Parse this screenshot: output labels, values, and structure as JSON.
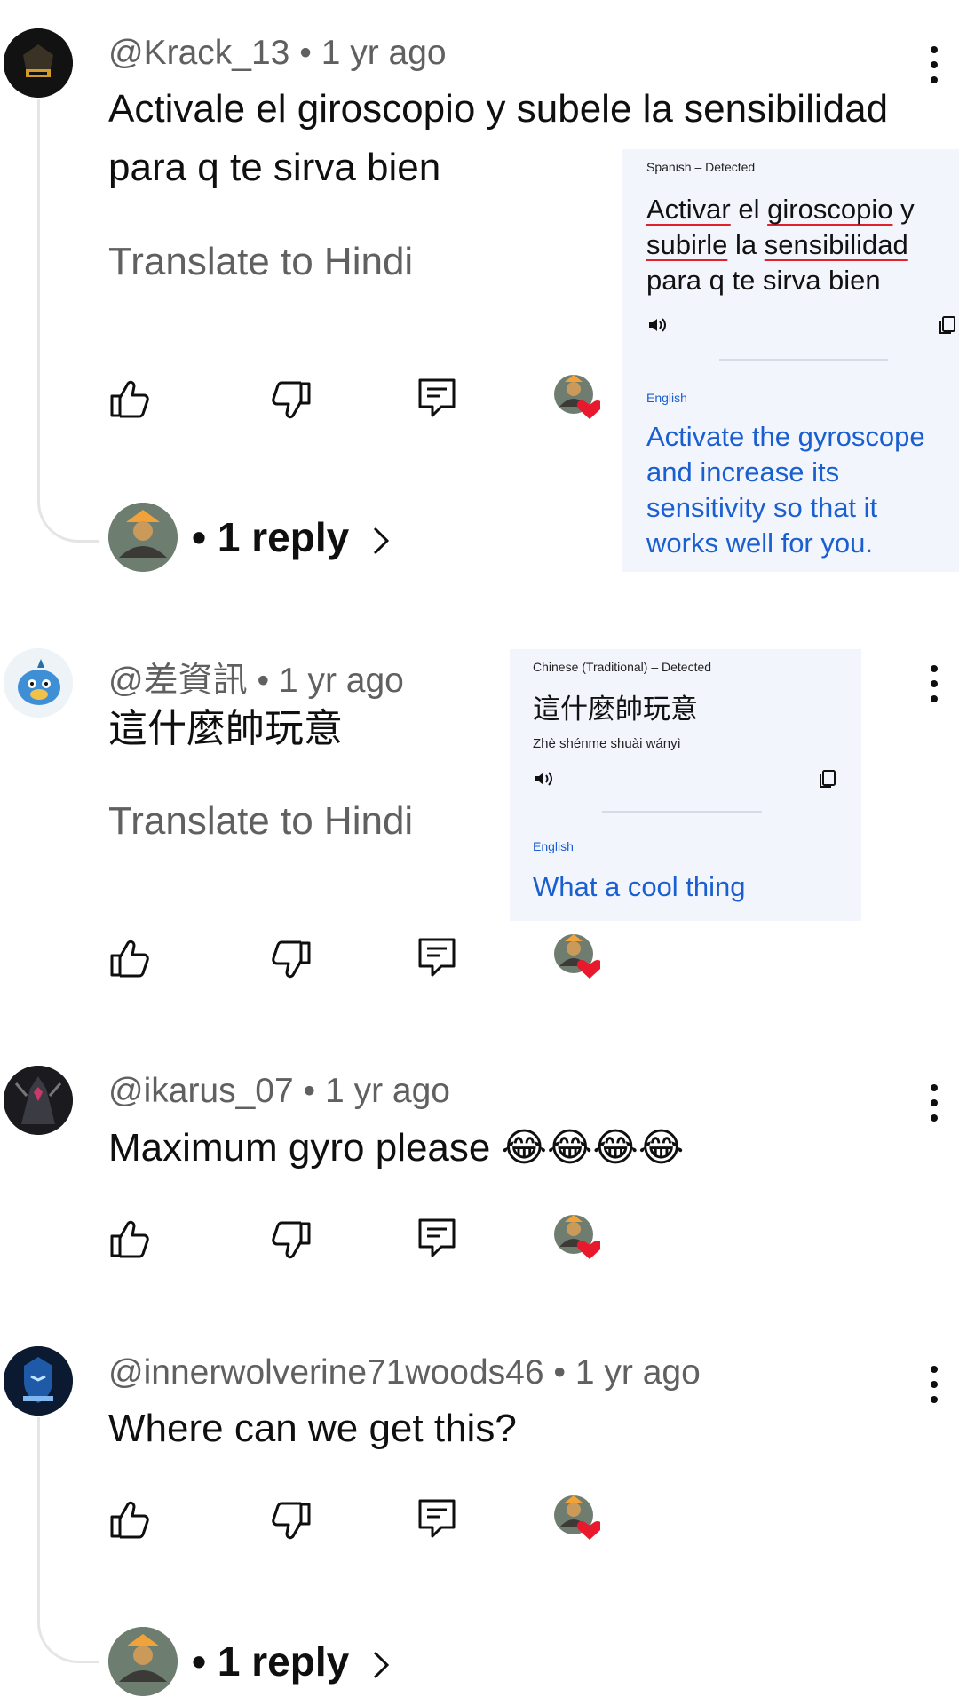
{
  "comments": [
    {
      "handle": "@Krack_13",
      "age": "1 yr ago",
      "text_line1": "Activale el giroscopio y subele la sensibilidad",
      "text_line2": "para q te sirva bien",
      "translate": "Translate to Hindi",
      "reply_text": "• 1 reply"
    },
    {
      "handle": "@差資訊",
      "age": "1 yr ago",
      "text_line1": "這什麼帥玩意",
      "translate": "Translate to Hindi"
    },
    {
      "handle": "@ikarus_07",
      "age": "1 yr ago",
      "text_line1": "Maximum gyro please 😂😂😂😂"
    },
    {
      "handle": "@innerwolverine71woods46",
      "age": "1 yr ago",
      "text_line1": "Where can we get this?",
      "reply_text": "• 1 reply"
    }
  ],
  "translate_cards": [
    {
      "source_label": "Spanish – Detected",
      "source_words": [
        "Activar",
        "el",
        "giroscopio",
        "y",
        "subirle",
        "la",
        "sensibilidad",
        "para q te sirva bien"
      ],
      "target_label": "English",
      "target_text": "Activate the gyroscope and increase its sensitivity so that it works well for you."
    },
    {
      "source_label": "Chinese (Traditional) – Detected",
      "source_text": "這什麼帥玩意",
      "romanization": "Zhè shénme shuài wányì",
      "target_label": "English",
      "target_text": "What a cool thing"
    }
  ],
  "colors": {
    "text": "#0f0f0f",
    "secondary": "#606060",
    "heart": "#e8192c",
    "translation_blue": "#1a5fd0",
    "card_bg": "#f3f5fd"
  },
  "icons": [
    "like-icon",
    "dislike-icon",
    "reply-icon",
    "creator-heart-icon",
    "more-vert-icon",
    "speaker-icon",
    "copy-icon",
    "chevron-right-icon"
  ]
}
